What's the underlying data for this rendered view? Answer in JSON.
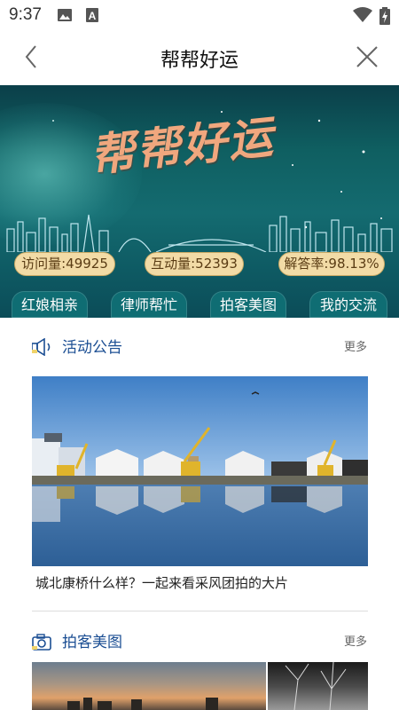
{
  "status_bar": {
    "time": "9:37",
    "icons": [
      "image-icon",
      "text-a-icon",
      "wifi-icon",
      "battery-charging-icon"
    ]
  },
  "header": {
    "title": "帮帮好运",
    "back_icon": "chevron-left-icon",
    "close_icon": "close-icon"
  },
  "banner": {
    "title": "帮帮好运",
    "stats": [
      {
        "label": "访问量:49925"
      },
      {
        "label": "互动量:52393"
      },
      {
        "label": "解答率:98.13%"
      }
    ],
    "nav": [
      {
        "label": "红娘相亲"
      },
      {
        "label": "律师帮忙"
      },
      {
        "label": "拍客美图"
      },
      {
        "label": "我的交流"
      }
    ]
  },
  "announcements": {
    "title": "活动公告",
    "icon": "speaker-icon",
    "more": "更多",
    "article": {
      "caption": "城北康桥什么样？一起来看采风团拍的大片"
    }
  },
  "photos": {
    "title": "拍客美图",
    "icon": "camera-icon",
    "more": "更多"
  },
  "colors": {
    "banner_teal": "#0f6d73",
    "pill_gold": "#f2dba6",
    "section_blue": "#1b4e93"
  }
}
